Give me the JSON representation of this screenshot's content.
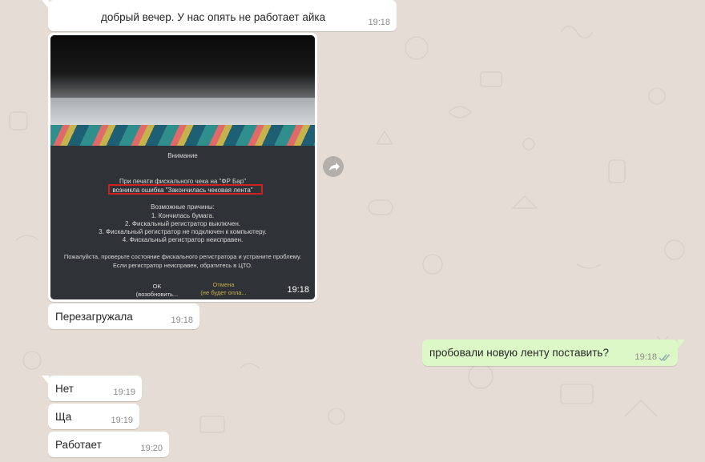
{
  "messages": [
    {
      "text": "добрый вечер. У нас опять не работает айка",
      "time": "19:18"
    },
    {
      "type": "image",
      "time": "19:18",
      "photo": {
        "dialog_title": "Внимание",
        "line1": "При печати фискального чека на \"ФР Бар\"",
        "line2": "возникла ошибка \"Закончилась чековая лента\"",
        "causes_title": "Возможные причины:",
        "cause1": "1. Кончилась бумага.",
        "cause2": "2. Фискальный регистратор выключен.",
        "cause3": "3. Фискальный регистратор не подключен к компьютеру.",
        "cause4": "4. Фискальный регистратор неисправен.",
        "advice1": "Пожалуйста, проверьте состояние фискального регистратора и устраните проблему.",
        "advice2": "Если регистратор неисправен, обратитесь в ЦТО.",
        "ok_label": "OK",
        "ok_sub": "(возобновить...",
        "cancel_label": "Отмена",
        "cancel_sub": "(не будет опла..."
      }
    },
    {
      "text": "Перезагружала",
      "time": "19:18"
    },
    {
      "text": "пробовали новую ленту поставить?",
      "time": "19:18",
      "outgoing": true
    },
    {
      "text": "Нет",
      "time": "19:19"
    },
    {
      "text": "Ща",
      "time": "19:19"
    },
    {
      "text": "Работает",
      "time": "19:20"
    }
  ],
  "colors": {
    "background": "#e5ddd5",
    "incoming": "#ffffff",
    "outgoing": "#dcf8c6",
    "read_tick": "#4fc3f7"
  },
  "icons": {
    "forward": "forward-arrow-icon",
    "read": "double-check-icon"
  }
}
